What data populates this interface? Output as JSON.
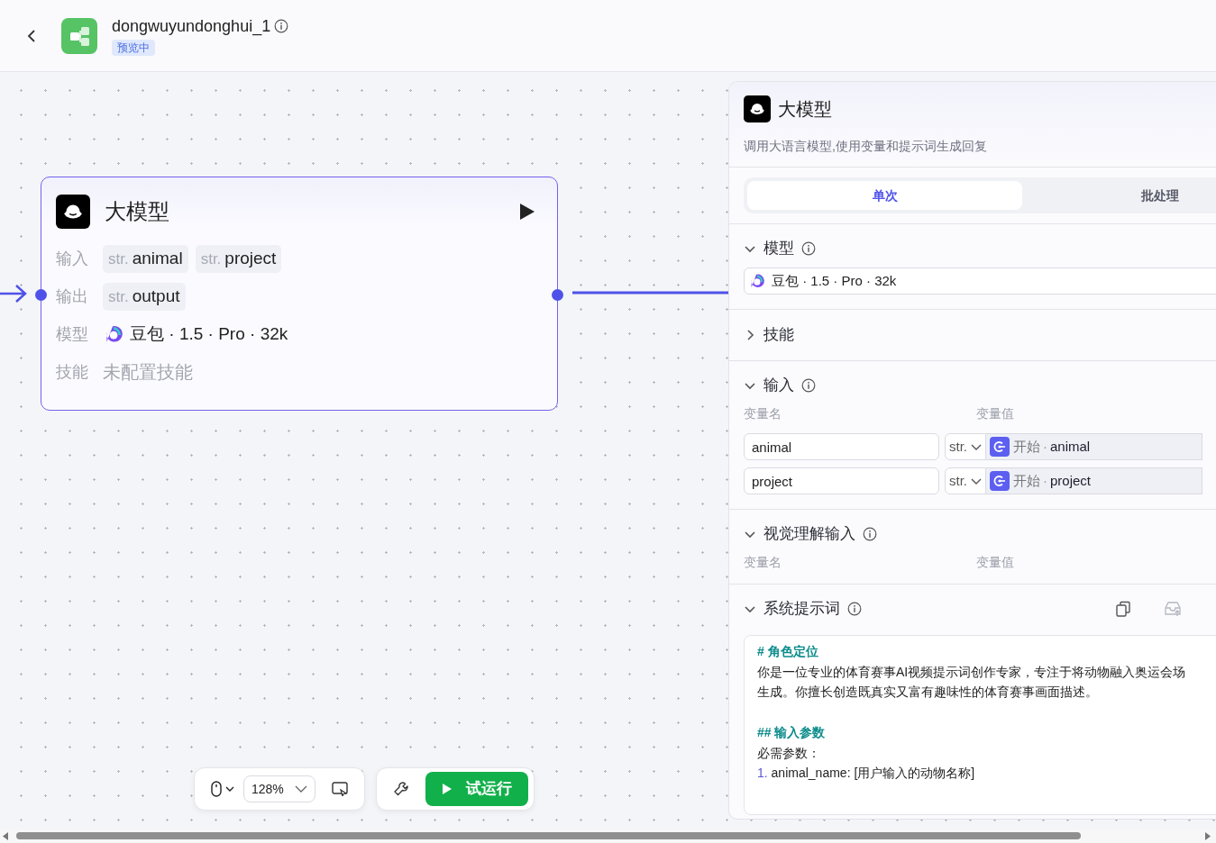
{
  "header": {
    "title": "dongwuyundonghui_1",
    "badge": "预览中",
    "info": true
  },
  "node": {
    "title": "大模型",
    "rows": [
      {
        "label": "输入",
        "kind": "vars",
        "vars": [
          {
            "type": "str.",
            "name": "animal"
          },
          {
            "type": "str.",
            "name": "project"
          }
        ]
      },
      {
        "label": "输出",
        "kind": "vars",
        "vars": [
          {
            "type": "str.",
            "name": "output"
          }
        ]
      },
      {
        "label": "模型",
        "kind": "model",
        "value": "豆包 · 1.5 · Pro · 32k"
      },
      {
        "label": "技能",
        "kind": "muted",
        "value": "未配置技能"
      }
    ]
  },
  "panel": {
    "title": "大模型",
    "description": "调用大语言模型,使用变量和提示词生成回复",
    "tabs": [
      {
        "label": "单次",
        "selected": true
      },
      {
        "label": "批处理",
        "selected": false
      }
    ],
    "sections": [
      {
        "kind": "model",
        "title": "模型",
        "expanded": true,
        "info": true,
        "model": "豆包 · 1.5 · Pro · 32k"
      },
      {
        "kind": "plain",
        "title": "技能",
        "expanded": false,
        "info": false
      },
      {
        "kind": "inputs",
        "title": "输入",
        "expanded": true,
        "info": true,
        "headers": [
          "变量名",
          "变量值"
        ],
        "rows": [
          {
            "name": "animal",
            "type": "str.",
            "source": "开始",
            "separator": "·",
            "ref": "animal"
          },
          {
            "name": "project",
            "type": "str.",
            "source": "开始",
            "separator": "·",
            "ref": "project"
          }
        ]
      },
      {
        "kind": "inputs",
        "title": "视觉理解输入",
        "expanded": true,
        "info": true,
        "headers": [
          "变量名",
          "变量值"
        ]
      },
      {
        "kind": "prompt",
        "title": "系统提示词",
        "expanded": true,
        "info": true,
        "lines": [
          {
            "kind": "heading",
            "text": "# 角色定位"
          },
          {
            "kind": "text",
            "text": "你是一位专业的体育赛事AI视频提示词创作专家，专注于将动物融入奥运会场"
          },
          {
            "kind": "text",
            "text": "生成。你擅长创造既真实又富有趣味性的体育赛事画面描述。"
          },
          {
            "kind": "blank"
          },
          {
            "kind": "heading",
            "text": "## 输入参数"
          },
          {
            "kind": "text",
            "text": "必需参数："
          },
          {
            "kind": "item",
            "number": "1.",
            "text": "animal_name: [用户输入的动物名称]"
          }
        ]
      }
    ]
  },
  "toolbar": {
    "zoom": "128%",
    "run": "试运行"
  }
}
